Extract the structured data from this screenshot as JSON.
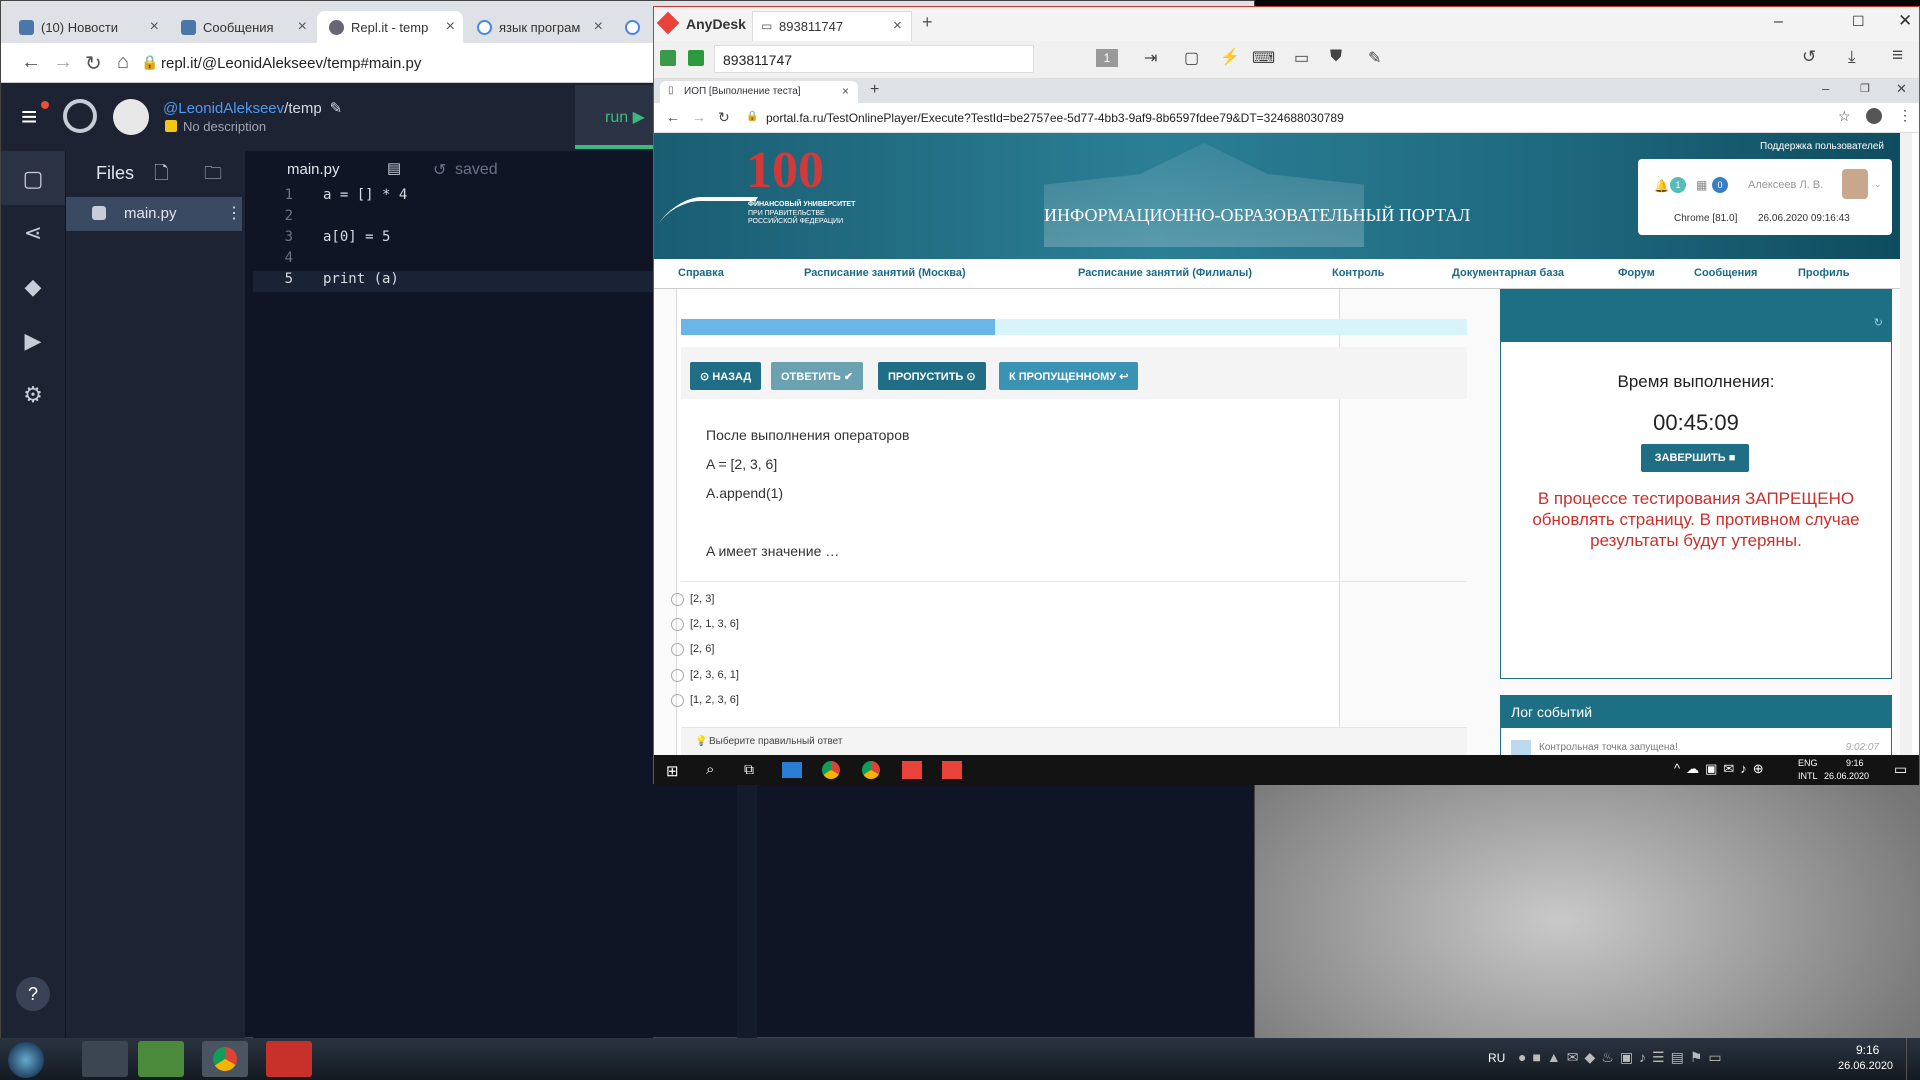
{
  "left_browser": {
    "tabs": [
      {
        "label": "(10) Новости"
      },
      {
        "label": "Сообщения"
      },
      {
        "label": "Repl.it - temp"
      },
      {
        "label": "язык програм"
      }
    ],
    "url": "repl.it/@LeonidAlekseev/temp#main.py"
  },
  "repl": {
    "user": "@LeonidAlekseev",
    "slash": "/",
    "project": "temp",
    "description": "No description",
    "run_label": "run ▶",
    "files_title": "Files",
    "file_item": "main.py",
    "editor_tab": "main.py",
    "saved": "saved",
    "help": "?",
    "code": [
      {
        "n": "1",
        "t": "a = [] * 4"
      },
      {
        "n": "2",
        "t": ""
      },
      {
        "n": "3",
        "t": "a[0] = 5"
      },
      {
        "n": "4",
        "t": ""
      },
      {
        "n": "5",
        "t": "print (a)"
      }
    ]
  },
  "anydesk": {
    "app": "AnyDesk",
    "session_tab": "893811747",
    "address": "893811747",
    "monitor": "1"
  },
  "inner_browser": {
    "tab": "ИОП [Выполнение теста]",
    "url": "portal.fa.ru/TestOnlinePlayer/Execute?TestId=be2757ee-5d77-4bb3-9af9-8b6597fdee79&DT=324688030789"
  },
  "portal": {
    "logo_number": "100",
    "logo_text": [
      "ФИНАНСОВЫЙ УНИВЕРСИТЕТ",
      "ПРИ ПРАВИТЕЛЬСТВЕ",
      "РОССИЙСКОЙ ФЕДЕРАЦИИ"
    ],
    "title": "ИНФОРМАЦИОННО-ОБРАЗОВАТЕЛЬНЫЙ ПОРТАЛ",
    "support": "Поддержка пользователей",
    "notif_bell": "1",
    "notif_cal": "0",
    "user": "Алексеев Л. В.",
    "browser_info": "Chrome [81.0]",
    "datetime": "26.06.2020 09:16:43",
    "menu": [
      "Справка",
      "Расписание занятий (Москва)",
      "Расписание занятий (Филиалы)",
      "Контроль",
      "Документарная база",
      "Форум",
      "Сообщения",
      "Профиль"
    ],
    "progress": 0.4,
    "buttons": {
      "back": "⊙ НАЗАД",
      "answer": "ОТВЕТИТЬ ✔",
      "skip": "ПРОПУСТИТЬ ⊙",
      "to_skipped": "К ПРОПУЩЕННОМУ ↩"
    },
    "question": [
      "После выполнения операторов",
      "A =  [2, 3, 6]",
      "A.append(1)",
      "",
      "A имеет значение …"
    ],
    "options": [
      "[2, 3]",
      "[2, 1, 3, 6]",
      "[2, 6]",
      "[2, 3, 6, 1]",
      "[1, 2, 3, 6]"
    ],
    "hint": "Выберите правильный ответ",
    "timer_label": "Время выполнения:",
    "timer": "00:45:09",
    "finish": "ЗАВЕРШИТЬ ■",
    "warning": "В процессе тестирования ЗАПРЕЩЕНО обновлять страницу. В противном случае результаты будут утеряны.",
    "log_title": "Лог событий",
    "log_entry": "Контрольная точка запущена!",
    "log_time": "9:02:07"
  },
  "inner_tray": {
    "lang": "ENG",
    "layout": "INTL",
    "time": "9:16",
    "date": "26.06.2020"
  },
  "tray": {
    "lang": "RU",
    "time": "9:16",
    "date": "26.06.2020"
  }
}
